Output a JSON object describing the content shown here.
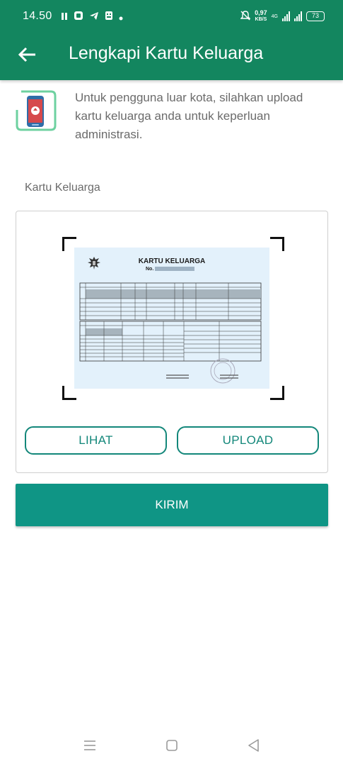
{
  "status_bar": {
    "time": "14.50",
    "speed_value": "0,97",
    "speed_unit": "KB/S",
    "network": "4G",
    "battery": "73"
  },
  "app_bar": {
    "title": "Lengkapi Kartu Keluarga",
    "back_icon": "arrow-left-icon"
  },
  "info": {
    "icon": "phone-upload-icon",
    "text": "Untuk pengguna luar kota, silahkan upload kartu keluarga anda untuk keperluan administrasi."
  },
  "document": {
    "label": "Kartu Keluarga",
    "sample_title": "KARTU KELUARGA",
    "sample_no": "No."
  },
  "buttons": {
    "view": "LIHAT",
    "upload": "UPLOAD",
    "submit": "KIRIM"
  },
  "colors": {
    "app_bar": "#13865f",
    "accent": "#13877a",
    "submit": "#0f9585"
  }
}
